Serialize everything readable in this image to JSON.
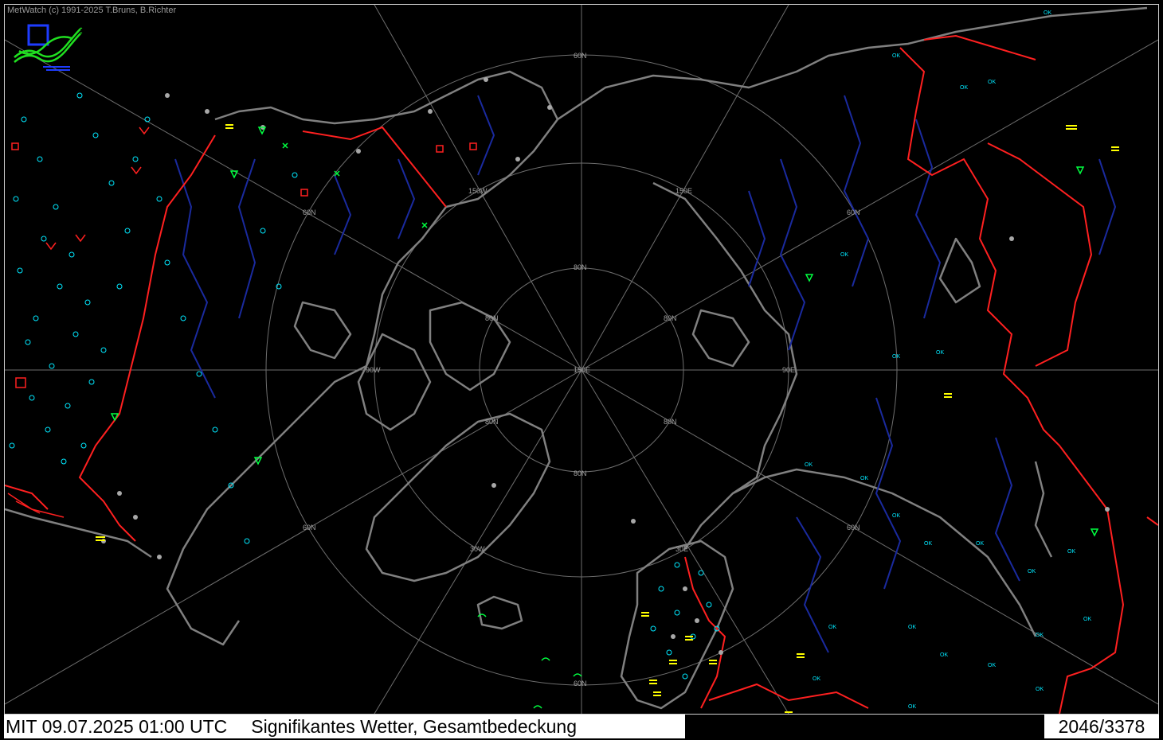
{
  "app": {
    "copyright": "MetWatch  (c) 1991-2025 T.Bruns, B.Richter"
  },
  "status": {
    "datetime": "MIT 09.07.2025 01:00 UTC",
    "product": "Signifikantes Wetter, Gesamtbedeckung",
    "counter": "2046/3378"
  },
  "grid_labels": {
    "lat60": "60N",
    "lat80": "80N",
    "lon150w": "150W",
    "lon150e": "150E",
    "lon90w": "90W",
    "lon90e": "90E",
    "lon30w": "30W",
    "lon30e": "30E",
    "center": "150E"
  },
  "station_markers": {
    "ok": "OK"
  },
  "colors": {
    "background": "#000000",
    "coastline": "#808080",
    "rivers": "#1a2a9e",
    "borders": "#ff2020",
    "graticule": "#8a8a8a",
    "station_cyan": "#00e8ff",
    "symbol_green": "#00ff40",
    "symbol_yellow": "#ffff00",
    "symbol_red": "#ff2020"
  },
  "icons": {
    "logo": "metwatch-wave-logo"
  }
}
